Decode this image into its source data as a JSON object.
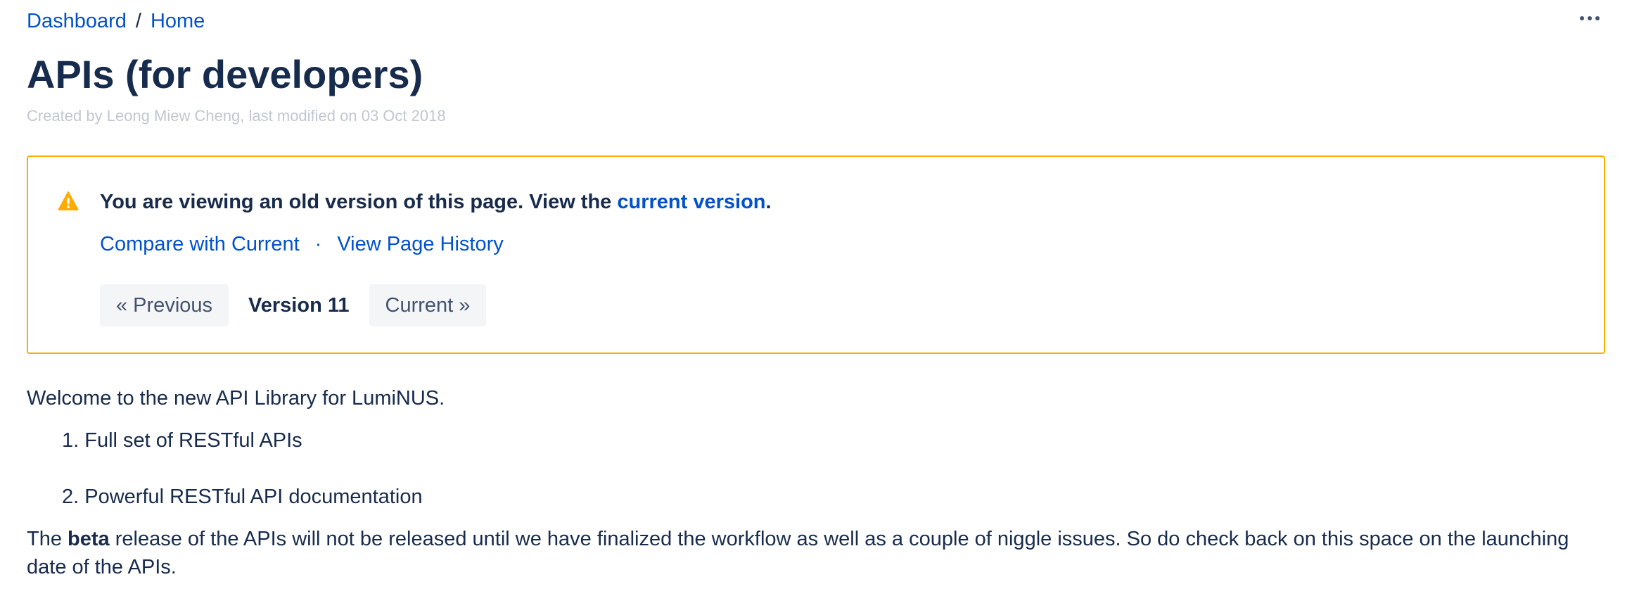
{
  "breadcrumb": {
    "items": [
      "Dashboard",
      "Home"
    ],
    "separator": "/"
  },
  "header": {
    "more_icon": "more-horizontal-icon"
  },
  "page": {
    "title": "APIs (for developers)",
    "meta": "Created by Leong Miew Cheng, last modified on 03 Oct 2018"
  },
  "warning": {
    "icon": "warning-icon",
    "message_prefix": "You are viewing an old version of this page. View the ",
    "message_link": "current version",
    "message_suffix": ".",
    "compare_link": "Compare with Current",
    "link_separator": "·",
    "history_link": "View Page History",
    "previous_button": "« Previous",
    "version_label": "Version 11",
    "current_button": "Current »"
  },
  "content": {
    "intro": "Welcome to the new API Library for LumiNUS.",
    "list": [
      "1. Full set of RESTful APIs",
      "2. Powerful RESTful API documentation"
    ],
    "note_prefix": "The ",
    "note_bold": "beta",
    "note_suffix": " release of the APIs will not be released until we have finalized the workflow as well as a couple of niggle issues. So do check back on this space on the launching date of the APIs."
  },
  "colors": {
    "link": "#0052cc",
    "text": "#172b4d",
    "muted": "#c1c7d0",
    "warning_border": "#ffab00",
    "button_bg": "#f4f5f7"
  }
}
